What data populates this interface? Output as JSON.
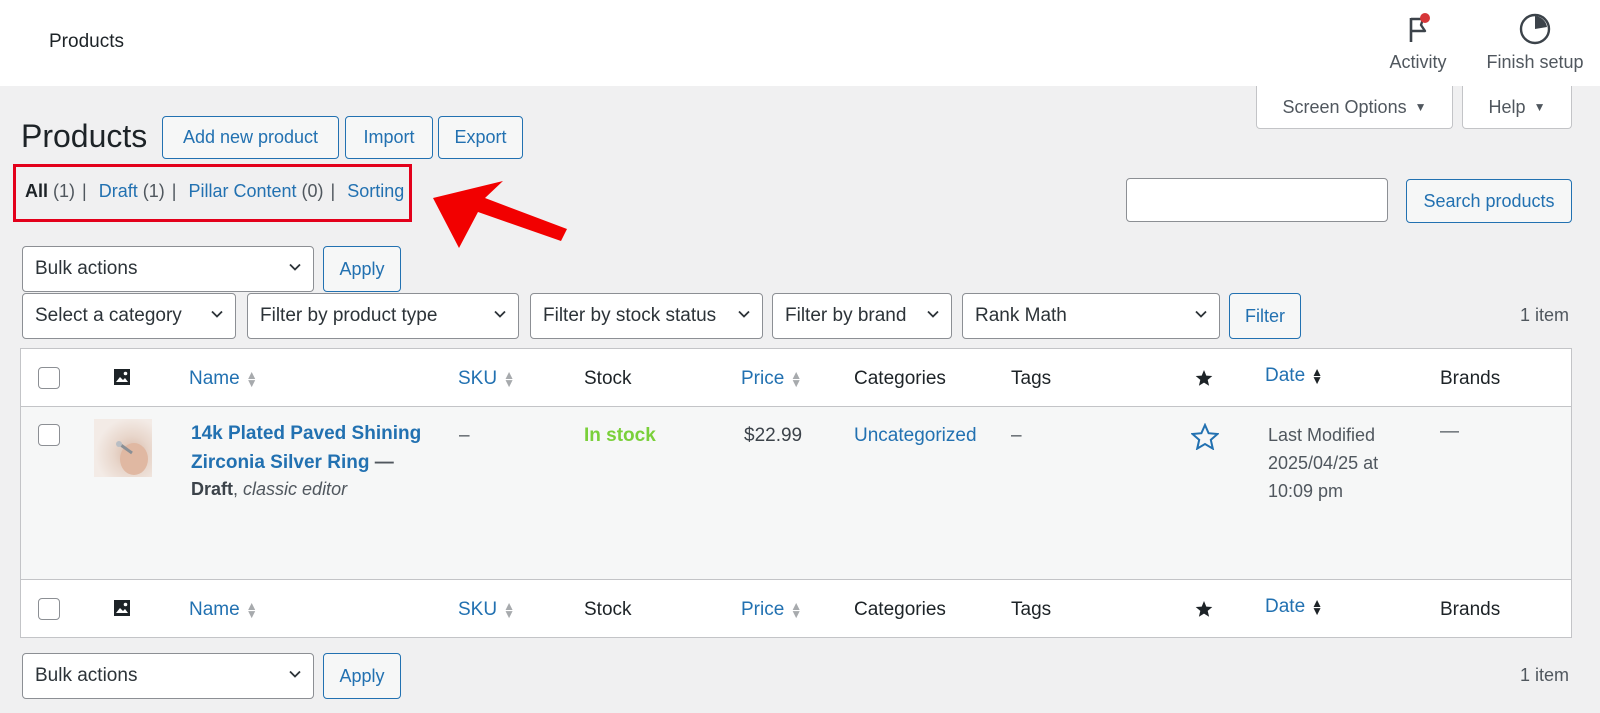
{
  "topbar": {
    "title": "Products",
    "activity_label": "Activity",
    "finish_label": "Finish setup"
  },
  "screen_options": {
    "screen_label": "Screen Options",
    "help_label": "Help"
  },
  "header": {
    "title": "Products",
    "add_new": "Add new product",
    "import": "Import",
    "export": "Export"
  },
  "views": [
    {
      "label": "All",
      "count": "(1)"
    },
    {
      "label": "Draft",
      "count": "(1)"
    },
    {
      "label": "Pillar Content",
      "count": "(0)"
    },
    {
      "label": "Sorting",
      "count": ""
    }
  ],
  "search": {
    "value": "",
    "button": "Search products"
  },
  "bulk": {
    "selected": "Bulk actions",
    "apply": "Apply"
  },
  "filters": {
    "category": "Select a category",
    "product_type": "Filter by product type",
    "stock_status": "Filter by stock status",
    "brand": "Filter by brand",
    "rank_math": "Rank Math",
    "button": "Filter"
  },
  "items_count": "1 item",
  "columns": {
    "name": "Name",
    "sku": "SKU",
    "stock": "Stock",
    "price": "Price",
    "categories": "Categories",
    "tags": "Tags",
    "date": "Date",
    "brands": "Brands"
  },
  "product": {
    "name_line1": "14k Plated Paved Shining",
    "name_line2": "Zirconia Silver Ring",
    "state_sep": " —",
    "status": "Draft",
    "editor": "classic editor",
    "sku": "–",
    "stock": "In stock",
    "price": "$22.99",
    "category": "Uncategorized",
    "tags": "–",
    "date_line1": "Last Modified",
    "date_line2": "2025/04/25 at",
    "date_line3": "10:09 pm",
    "brands": "—"
  },
  "colors": {
    "accent": "#2271b1",
    "in_stock": "#7ad03a",
    "annotation": "#e3001b"
  }
}
